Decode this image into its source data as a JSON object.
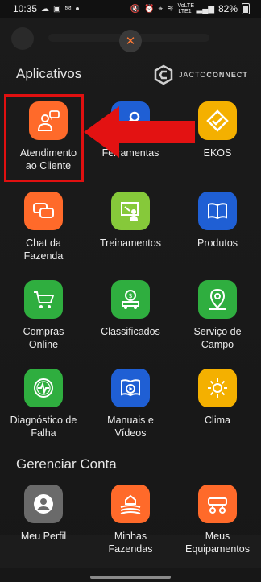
{
  "status_bar": {
    "time": "10:35",
    "battery": "82%",
    "volte": "VoLTE\nLTE1"
  },
  "close": {
    "glyph": "✕"
  },
  "brand": {
    "name_light": "JACTO",
    "name_bold": "CONNECT"
  },
  "section_apps": {
    "title": "Aplicativos"
  },
  "section_account": {
    "title": "Gerenciar Conta"
  },
  "apps": [
    {
      "label": "Atendimento\nao Cliente",
      "icon": "customer-service-icon",
      "color": "#ff6a2a"
    },
    {
      "label": "Ferramentas",
      "icon": "tools-icon",
      "color": "#1f5fd4"
    },
    {
      "label": "EKOS",
      "icon": "ekos-icon",
      "color": "#f4b000"
    },
    {
      "label": "Chat da\nFazenda",
      "icon": "chat-icon",
      "color": "#ff6a2a"
    },
    {
      "label": "Treinamentos",
      "icon": "training-icon",
      "color": "#86c93a"
    },
    {
      "label": "Produtos",
      "icon": "book-icon",
      "color": "#1f5fd4"
    },
    {
      "label": "Compras\nOnline",
      "icon": "cart-icon",
      "color": "#2fae3f"
    },
    {
      "label": "Classificados",
      "icon": "classifieds-icon",
      "color": "#2fae3f"
    },
    {
      "label": "Serviço de\nCampo",
      "icon": "map-pin-icon",
      "color": "#2fae3f"
    },
    {
      "label": "Diagnóstico de\nFalha",
      "icon": "diagnostic-icon",
      "color": "#2fae3f"
    },
    {
      "label": "Manuais e\nVídeos",
      "icon": "manual-video-icon",
      "color": "#1f5fd4"
    },
    {
      "label": "Clima",
      "icon": "sun-icon",
      "color": "#f4b000"
    }
  ],
  "account": [
    {
      "label": "Meu Perfil",
      "icon": "profile-icon",
      "color": "#6a6a6a"
    },
    {
      "label": "Minhas\nFazendas",
      "icon": "farm-icon",
      "color": "#ff6a2a"
    },
    {
      "label": "Meus\nEquipamentos",
      "icon": "equipment-icon",
      "color": "#ff6a2a"
    }
  ]
}
